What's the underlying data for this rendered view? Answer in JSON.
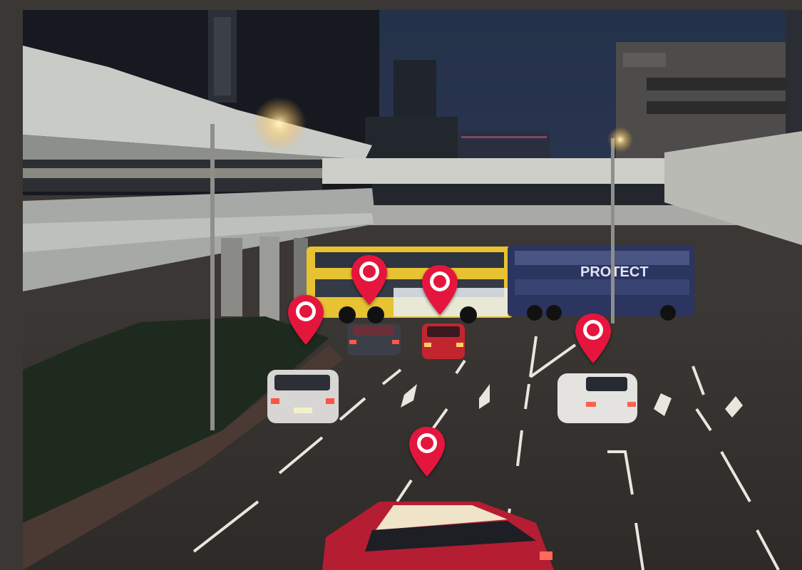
{
  "scene": {
    "description_icon": "city-street-photo",
    "sky_color": "#1b2636",
    "road_color": "#2e2b29",
    "marker_color": "#e5163d"
  },
  "bus_left": {
    "text": "PROTECT"
  },
  "markers": [
    {
      "name": "marker-car-left",
      "icon": "map-pin-icon"
    },
    {
      "name": "marker-car-center-back",
      "icon": "map-pin-icon"
    },
    {
      "name": "marker-car-center-red",
      "icon": "map-pin-icon"
    },
    {
      "name": "marker-car-right-white",
      "icon": "map-pin-icon"
    },
    {
      "name": "marker-taxi-front",
      "icon": "map-pin-icon"
    }
  ]
}
